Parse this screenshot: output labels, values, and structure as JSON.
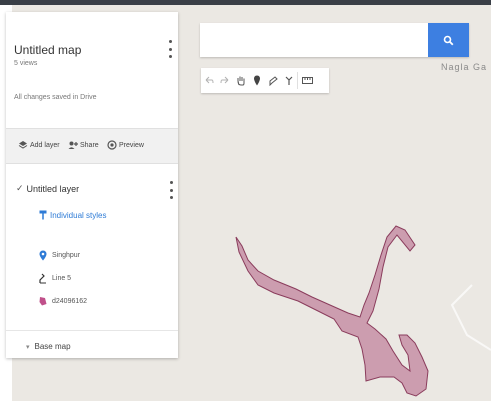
{
  "map": {
    "title": "Untitled map",
    "views": "5 views",
    "save_status": "All changes saved in Drive",
    "place_label": "Nagla Ga"
  },
  "actions": {
    "add_layer": "Add layer",
    "share": "Share",
    "preview": "Preview"
  },
  "layer": {
    "name": "Untitled layer",
    "style_link": "Individual styles",
    "features": [
      {
        "label": "Singhpur",
        "icon": "marker-icon"
      },
      {
        "label": "Line 5",
        "icon": "line-icon"
      },
      {
        "label": "d24096162",
        "icon": "polygon-icon"
      }
    ]
  },
  "base_map": {
    "label": "Base map"
  },
  "search": {
    "placeholder": "",
    "value": ""
  },
  "toolbar": {
    "tools": [
      "undo-icon",
      "redo-icon",
      "hand-icon",
      "marker-icon",
      "draw-line-icon",
      "directions-icon",
      "ruler-icon"
    ]
  },
  "colors": {
    "polygon_fill": "#c78fa6",
    "polygon_stroke": "#8a3c5c",
    "accent_blue": "#3d7fe1",
    "map_background": "#ebe8e3"
  }
}
